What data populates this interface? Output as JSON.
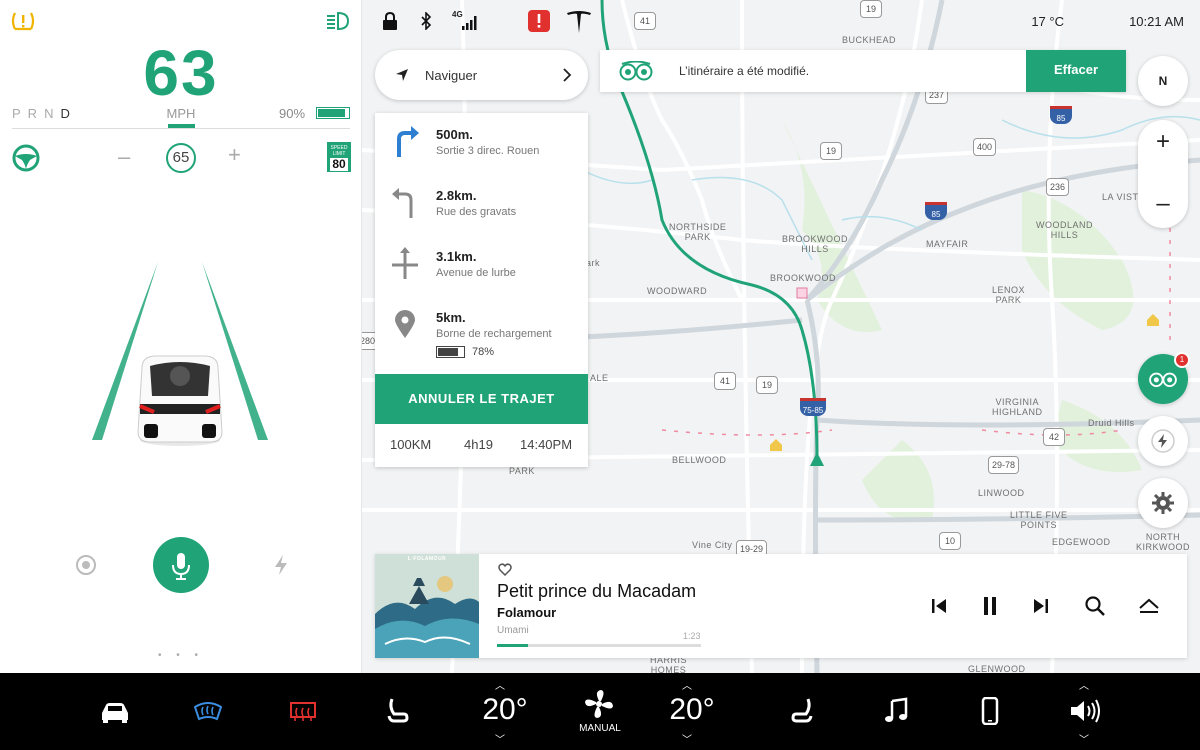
{
  "driver_panel": {
    "speed": "63",
    "gears": [
      "P",
      "R",
      "N",
      "D"
    ],
    "gear_selected": "D",
    "speed_unit": "MPH",
    "battery_percent": "90%",
    "battery_level": 0.9,
    "cruise_minus": "–",
    "cruise_set_speed": "65",
    "cruise_plus": "+",
    "speed_limit_label": "SPEED LIMIT",
    "speed_limit_value": "80",
    "page_dots": "• • •",
    "icons": [
      "tpms-warning-icon",
      "headlight-icon",
      "steering-wheel-icon",
      "camera-icon",
      "microphone-icon",
      "lightning-icon"
    ]
  },
  "status_bar": {
    "network": "4G",
    "temperature": "17 °C",
    "time": "10:21 AM",
    "icons": [
      "lock-icon",
      "bluetooth-icon",
      "signal-icon",
      "alert-icon",
      "tesla-logo-icon"
    ]
  },
  "navigation": {
    "search_label": "Naviguer",
    "steps": [
      {
        "distance": "500m.",
        "name": "Sortie 3 direc. Rouen",
        "icon": "turn-right-icon"
      },
      {
        "distance": "2.8km.",
        "name": "Rue des gravats",
        "icon": "turn-left-icon"
      },
      {
        "distance": "3.1km.",
        "name": "Avenue de lurbe",
        "icon": "crossroad-icon"
      },
      {
        "distance": "5km.",
        "name": "Borne de rechargement",
        "icon": "location-pin-icon",
        "battery": "78%",
        "battery_level": 0.78
      }
    ],
    "cancel_label": "ANNULER LE TRAJET",
    "trip": {
      "distance": "100KM",
      "duration": "4h19",
      "arrival": "14:40PM"
    }
  },
  "notification": {
    "message": "L’itinéraire a été modifié.",
    "action": "Effacer",
    "icon": "tripadvisor-icon"
  },
  "map_controls": {
    "compass": "N",
    "zoom_in": "+",
    "zoom_out": "–",
    "badge_count": "1"
  },
  "map_labels": {
    "places": [
      "BUCKHEAD",
      "NORTHSIDE\nPARK",
      "BROOKWOOD\nHILLS",
      "BROOKWOOD",
      "MAYFAIR",
      "WOODLAND\nHILLS",
      "LA VISTA",
      "LENOX\nPARK",
      "WOODWARD",
      "ALE",
      "ark",
      "VIRGINIA\nHIGHLAND",
      "Druid Hills",
      "BELLWOOD",
      "LINWOOD",
      "LITTLE FIVE\nPOINTS",
      "Vine City",
      "EDGEWOOD",
      "NORTH\nKIRKWOOD",
      "HARRIS\nHOMES",
      "GLENWOOD",
      "PARK"
    ],
    "shields": [
      "41",
      "19",
      "237",
      "19",
      "400",
      "236",
      "41",
      "19",
      "42",
      "29-78",
      "10",
      "19-29",
      "280"
    ],
    "interstates": [
      "85",
      "85",
      "75-85"
    ]
  },
  "media": {
    "title": "Petit prince du Macadam",
    "artist": "Folamour",
    "album": "Umami",
    "time": "1:23",
    "progress": 0.15,
    "album_art_text": "L·FOLAMOUR"
  },
  "climate_bar": {
    "left_temp": "20°",
    "right_temp": "20°",
    "fan_mode": "MANUAL",
    "icons": [
      "car-icon",
      "front-defrost-icon",
      "rear-defrost-icon",
      "seat-heater-left-icon",
      "fan-icon",
      "seat-heater-right-icon",
      "music-note-icon",
      "phone-icon",
      "volume-icon"
    ]
  },
  "colors": {
    "accent": "#20a477",
    "alert": "#e0312f",
    "bar": "#000000"
  }
}
